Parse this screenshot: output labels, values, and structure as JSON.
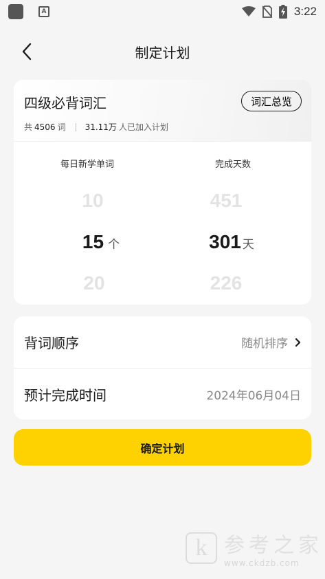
{
  "status_bar": {
    "time": "3:22"
  },
  "header": {
    "title": "制定计划",
    "back_icon": "chevron-left-icon"
  },
  "plan": {
    "book_title": "四级必背词汇",
    "overview_button": "词汇总览",
    "word_count_prefix": "共",
    "word_count": "4506",
    "word_count_unit": "词",
    "learners_count": "31.11万",
    "learners_suffix": "人已加入计划"
  },
  "pickers": {
    "daily": {
      "label": "每日新学单词",
      "values": [
        "10",
        "15",
        "20"
      ],
      "selected": "15",
      "unit": "个"
    },
    "days": {
      "label": "完成天数",
      "values": [
        "451",
        "301",
        "226"
      ],
      "selected": "301",
      "unit": "天"
    }
  },
  "options": {
    "order": {
      "label": "背词顺序",
      "value": "随机排序"
    },
    "finish": {
      "label": "预计完成时间",
      "value": "2024年06月04日"
    }
  },
  "confirm_button": "确定计划",
  "watermark": {
    "logo_letter": "k",
    "text": "参考之家",
    "url": "www.ckdzb.com"
  },
  "colors": {
    "accent": "#fdd200",
    "background": "#f5f5f5",
    "card": "#ffffff"
  }
}
